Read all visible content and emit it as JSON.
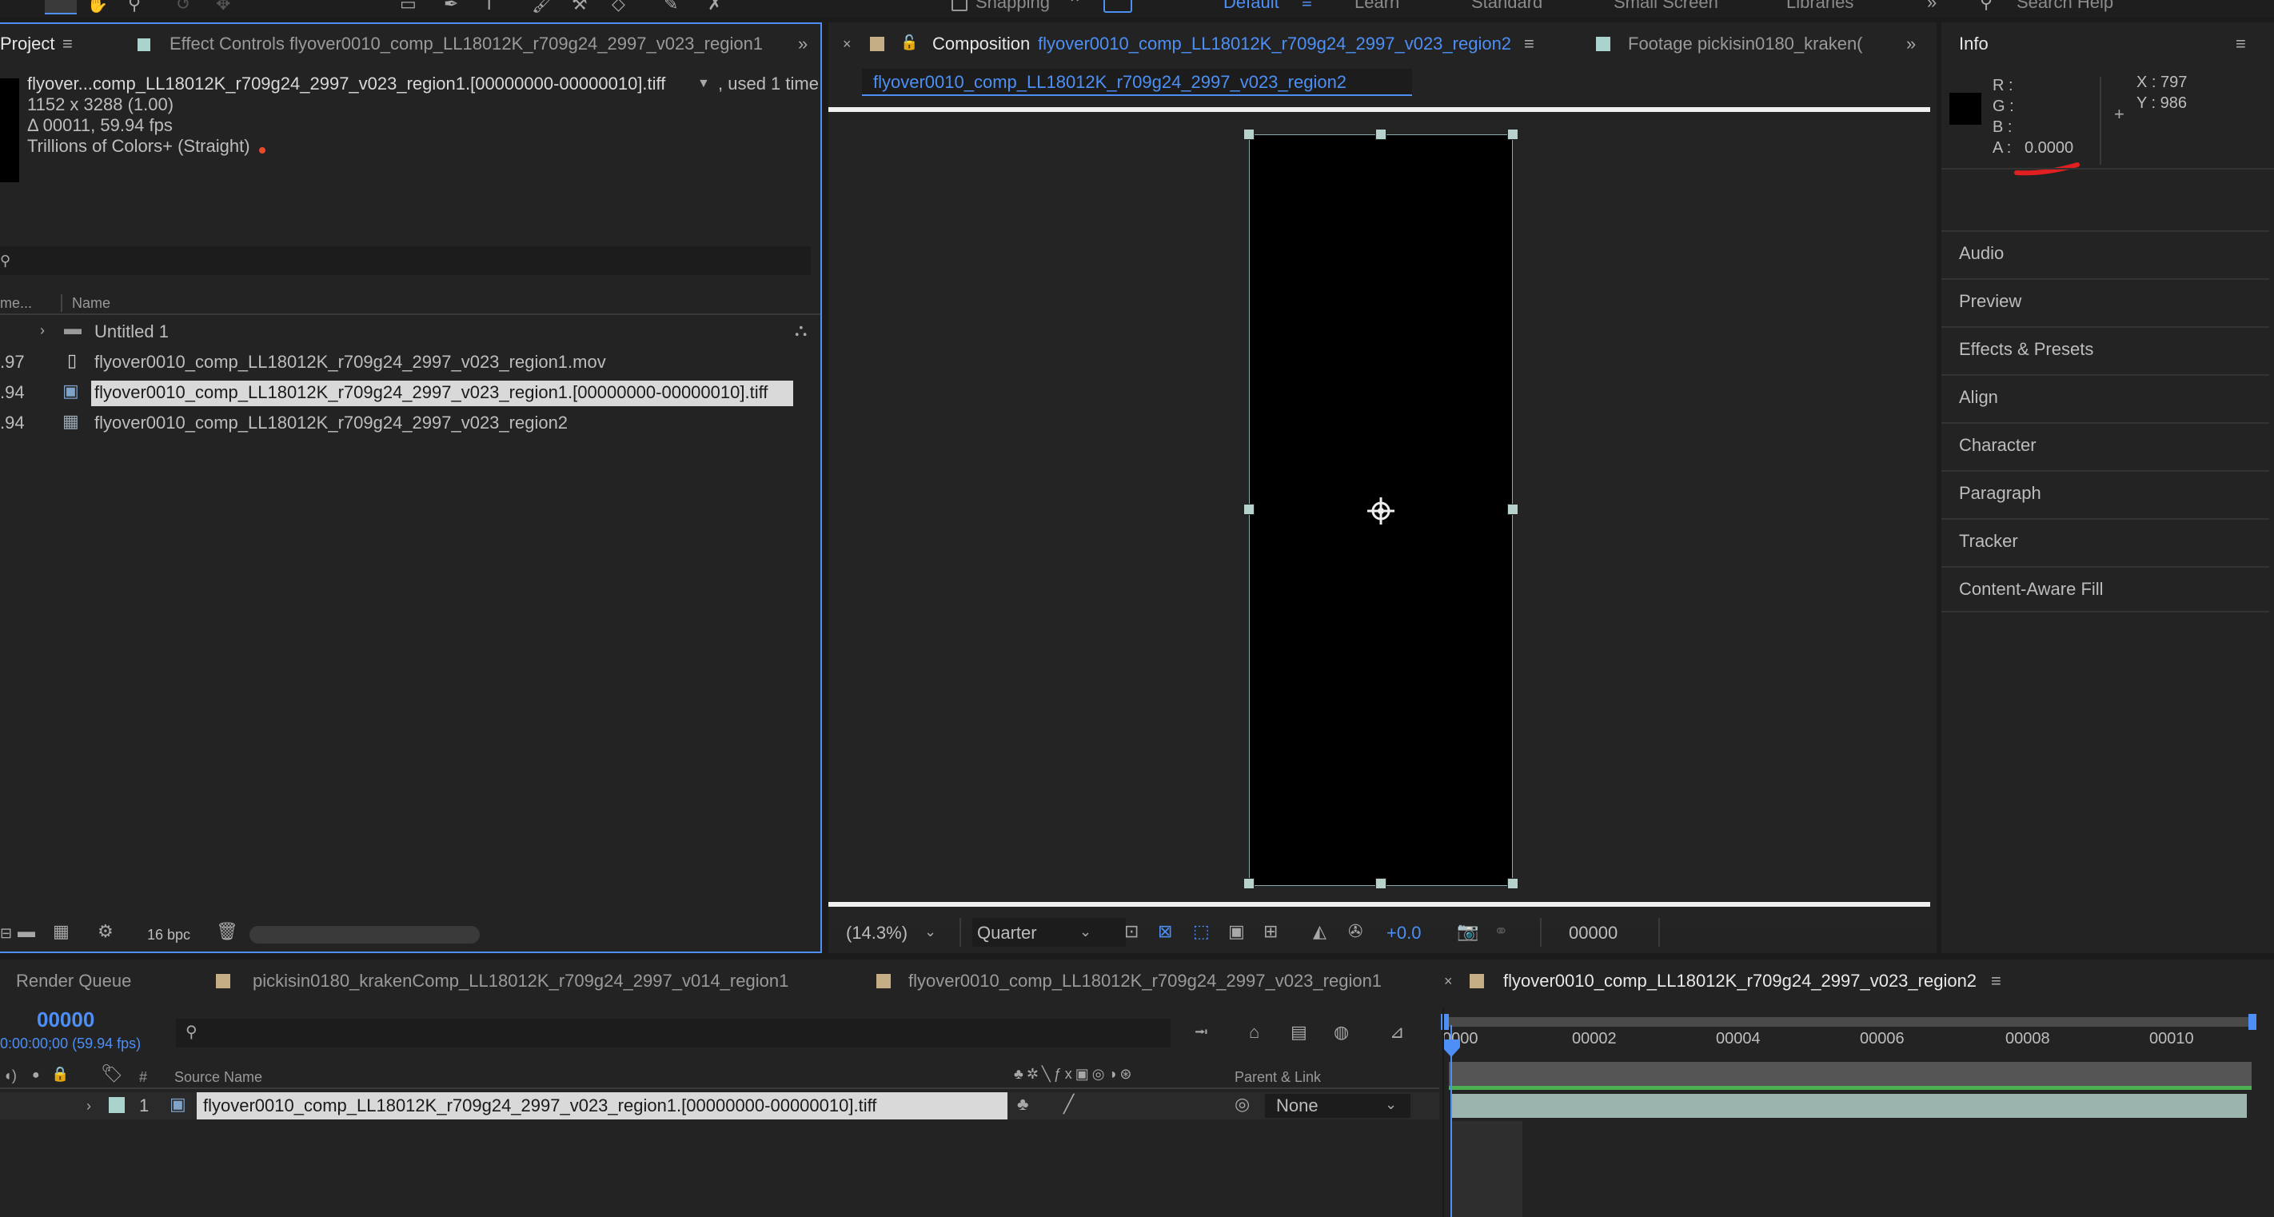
{
  "toolbar": {
    "snapping": "Snapping",
    "workspaces": [
      "Default",
      "Learn",
      "Standard",
      "Small Screen",
      "Libraries"
    ],
    "search_placeholder": "Search Help"
  },
  "project": {
    "tab_label": "Project",
    "effect_controls_tab": "Effect Controls flyover0010_comp_LL18012K_r709g24_2997_v023_region1",
    "info_name": "flyover...comp_LL18012K_r709g24_2997_v023_region1.[00000000-00000010].tiff",
    "info_used": ", used 1 time",
    "info_dims": "1152 x 3288 (1.00)",
    "info_duration": "Δ 00011, 59.94 fps",
    "info_colors": "Trillions of Colors+ (Straight)",
    "col_frame": "me...",
    "col_name": "Name",
    "items": [
      {
        "frame": "",
        "name": "Untitled 1",
        "type": "folder"
      },
      {
        "frame": ".97",
        "name": "flyover0010_comp_LL18012K_r709g24_2997_v023_region1.mov",
        "type": "movie"
      },
      {
        "frame": ".94",
        "name": "flyover0010_comp_LL18012K_r709g24_2997_v023_region1.[00000000-00000010].tiff",
        "type": "sequence",
        "selected": true
      },
      {
        "frame": ".94",
        "name": "flyover0010_comp_LL18012K_r709g24_2997_v023_region2",
        "type": "comp"
      }
    ],
    "bpc": "16 bpc"
  },
  "composition": {
    "tab_prefix": "Composition",
    "tab_name": "flyover0010_comp_LL18012K_r709g24_2997_v023_region2",
    "footage_tab": "Footage pickisin0180_kraken(",
    "sub_tab": "flyover0010_comp_LL18012K_r709g24_2997_v023_region2",
    "zoom": "(14.3%)",
    "resolution": "Quarter",
    "exposure": "+0.0",
    "timecode": "00000"
  },
  "info": {
    "title": "Info",
    "r_label": "R :",
    "g_label": "G :",
    "b_label": "B :",
    "a_label": "A :",
    "a_value": "0.0000",
    "x_label": "X : 797",
    "y_label": "Y : 986",
    "sections": [
      "Audio",
      "Preview",
      "Effects & Presets",
      "Align",
      "Character",
      "Paragraph",
      "Tracker",
      "Content-Aware Fill"
    ]
  },
  "timeline": {
    "tabs": [
      "Render Queue",
      "pickisin0180_krakenComp_LL18012K_r709g24_2997_v014_region1",
      "flyover0010_comp_LL18012K_r709g24_2997_v023_region1",
      "flyover0010_comp_LL18012K_r709g24_2997_v023_region2"
    ],
    "current_time": "00000",
    "time_sub": "0:00:00;00 (59.94 fps)",
    "col_number": "#",
    "col_source": "Source Name",
    "col_parent": "Parent & Link",
    "ruler": [
      "0000",
      "00002",
      "00004",
      "00006",
      "00008",
      "00010"
    ],
    "layer_number": "1",
    "layer_name": "flyover0010_comp_LL18012K_r709g24_2997_v023_region1.[00000000-00000010].tiff",
    "parent_value": "None"
  },
  "colors": {
    "accent": "#4d8ff5",
    "background": "#232323",
    "selection": "#d9d9d9",
    "layer_bar": "#9bb5ae"
  }
}
